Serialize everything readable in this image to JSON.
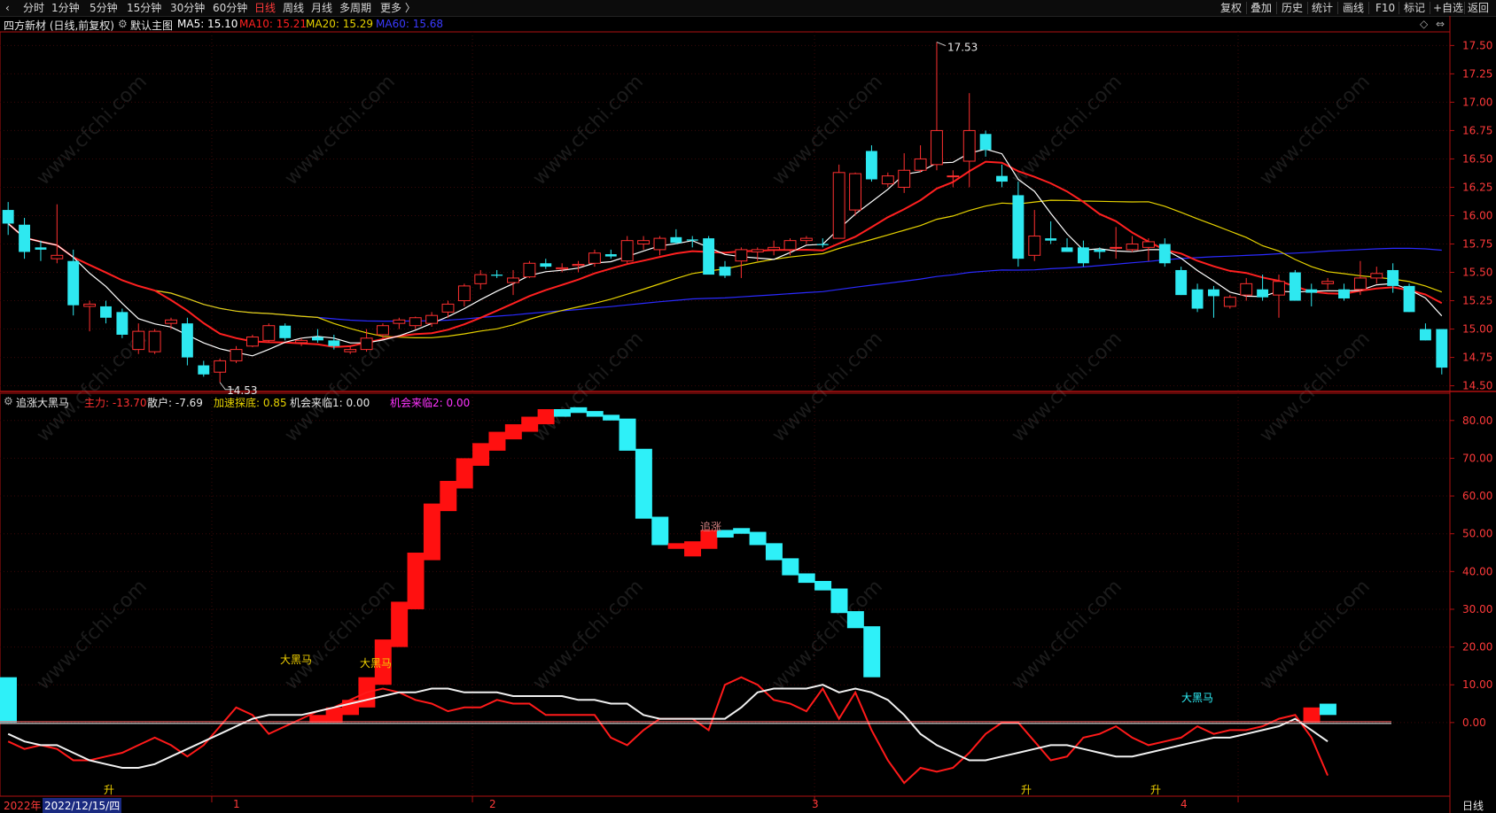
{
  "toolbar": {
    "tabs": [
      "分时",
      "1分钟",
      "5分钟",
      "15分钟",
      "30分钟",
      "60分钟",
      "日线",
      "周线",
      "月线",
      "多周期",
      "更多 〉"
    ],
    "active_tab": "日线",
    "right_buttons": [
      "复权",
      "叠加",
      "历史",
      "统计",
      "画线",
      "F10",
      "标记",
      "+自选",
      "返回"
    ]
  },
  "main_chart": {
    "stock_title": "四方新材 (日线,前复权)",
    "template": "默认主图",
    "ma5": {
      "label": "MA5: 15.10",
      "color": "#ffffff"
    },
    "ma10": {
      "label": "MA10: 15.21",
      "color": "#ff2020"
    },
    "ma20": {
      "label": "MA20: 15.29",
      "color": "#e6d200"
    },
    "ma60": {
      "label": "MA60: 15.68",
      "color": "#2a2aff"
    },
    "high_label": "17.53",
    "low_label": "14.53",
    "price_ticks": [
      "17.50",
      "17.25",
      "17.00",
      "16.75",
      "16.50",
      "16.25",
      "16.00",
      "15.75",
      "15.50",
      "15.25",
      "15.00",
      "14.75",
      "14.50"
    ]
  },
  "indicator": {
    "name": "追涨大黑马",
    "main_force": "主力: -13.70",
    "retail": "散户: -7.69",
    "accel": "加速探底: 0.85",
    "chance1": "机会来临1: 0.00",
    "chance2": "机会来临2: 0.00",
    "ticks": [
      "80.00",
      "70.00",
      "60.00",
      "50.00",
      "40.00",
      "30.00",
      "20.00",
      "10.00",
      "0.00"
    ],
    "annotations": {
      "dhm1": "大黑马",
      "dhm2": "大黑马",
      "dhm3": "大黑马",
      "zhuizhang": "追涨",
      "sheng1": "升",
      "sheng2": "升",
      "sheng3": "升"
    }
  },
  "time_axis": {
    "year_label": "2022年",
    "date_cursor": "2022/12/15/四",
    "months": [
      "1",
      "2",
      "3",
      "4"
    ],
    "period": "日线"
  },
  "watermark": "www.cfchi.com",
  "chart_data": [
    {
      "type": "candlestick",
      "title": "四方新材 (日线,前复权)",
      "ylim": [
        14.45,
        17.62
      ],
      "candles": [
        [
          16.05,
          16.12,
          15.83,
          15.93
        ],
        [
          15.92,
          15.98,
          15.62,
          15.68
        ],
        [
          15.72,
          15.78,
          15.6,
          15.7
        ],
        [
          15.62,
          16.1,
          15.58,
          15.65
        ],
        [
          15.6,
          15.7,
          15.12,
          15.21
        ],
        [
          15.2,
          15.25,
          14.98,
          15.22
        ],
        [
          15.2,
          15.25,
          15.05,
          15.1
        ],
        [
          15.15,
          15.18,
          14.92,
          14.95
        ],
        [
          14.82,
          15.05,
          14.78,
          14.98
        ],
        [
          14.8,
          15.0,
          14.78,
          14.98
        ],
        [
          15.05,
          15.1,
          15.0,
          15.08
        ],
        [
          15.05,
          15.1,
          14.68,
          14.75
        ],
        [
          14.68,
          14.72,
          14.58,
          14.6
        ],
        [
          14.62,
          14.74,
          14.53,
          14.72
        ],
        [
          14.72,
          14.85,
          14.7,
          14.82
        ],
        [
          14.85,
          14.95,
          14.84,
          14.93
        ],
        [
          14.9,
          15.05,
          14.88,
          15.03
        ],
        [
          15.03,
          15.05,
          14.9,
          14.92
        ],
        [
          14.88,
          14.92,
          14.85,
          14.9
        ],
        [
          14.93,
          15.0,
          14.88,
          14.9
        ],
        [
          14.9,
          14.95,
          14.82,
          14.85
        ],
        [
          14.8,
          14.85,
          14.78,
          14.82
        ],
        [
          14.82,
          15.0,
          14.8,
          14.92
        ],
        [
          14.95,
          15.05,
          14.92,
          15.03
        ],
        [
          15.05,
          15.1,
          15.0,
          15.08
        ],
        [
          15.03,
          15.11,
          15.0,
          15.1
        ],
        [
          15.05,
          15.15,
          15.02,
          15.12
        ],
        [
          15.15,
          15.25,
          15.1,
          15.22
        ],
        [
          15.25,
          15.4,
          15.2,
          15.38
        ],
        [
          15.4,
          15.52,
          15.35,
          15.48
        ],
        [
          15.48,
          15.52,
          15.45,
          15.47
        ],
        [
          15.41,
          15.52,
          15.3,
          15.45
        ],
        [
          15.46,
          15.6,
          15.45,
          15.58
        ],
        [
          15.58,
          15.62,
          15.53,
          15.55
        ],
        [
          15.53,
          15.58,
          15.5,
          15.54
        ],
        [
          15.56,
          15.6,
          15.5,
          15.57
        ],
        [
          15.58,
          15.7,
          15.55,
          15.67
        ],
        [
          15.66,
          15.7,
          15.62,
          15.64
        ],
        [
          15.6,
          15.82,
          15.58,
          15.78
        ],
        [
          15.75,
          15.82,
          15.7,
          15.78
        ],
        [
          15.7,
          15.82,
          15.65,
          15.8
        ],
        [
          15.81,
          15.88,
          15.75,
          15.76
        ],
        [
          15.79,
          15.82,
          15.72,
          15.78
        ],
        [
          15.8,
          15.82,
          15.65,
          15.48
        ],
        [
          15.55,
          15.6,
          15.45,
          15.47
        ],
        [
          15.6,
          15.72,
          15.45,
          15.7
        ],
        [
          15.68,
          15.72,
          15.6,
          15.7
        ],
        [
          15.7,
          15.78,
          15.65,
          15.72
        ],
        [
          15.7,
          15.8,
          15.65,
          15.78
        ],
        [
          15.78,
          15.82,
          15.75,
          15.8
        ],
        [
          15.75,
          15.8,
          15.72,
          15.74
        ],
        [
          15.8,
          16.45,
          15.85,
          16.38
        ],
        [
          16.05,
          16.38,
          16.0,
          16.37
        ],
        [
          16.57,
          16.62,
          16.3,
          16.32
        ],
        [
          16.28,
          16.38,
          16.25,
          16.35
        ],
        [
          16.25,
          16.55,
          16.2,
          16.4
        ],
        [
          16.4,
          16.62,
          16.38,
          16.5
        ],
        [
          16.45,
          17.53,
          16.4,
          16.75
        ],
        [
          16.35,
          16.4,
          16.25,
          16.35
        ],
        [
          16.48,
          17.08,
          16.25,
          16.75
        ],
        [
          16.72,
          16.75,
          16.52,
          16.58
        ],
        [
          16.35,
          16.45,
          16.25,
          16.3
        ],
        [
          16.18,
          16.3,
          15.55,
          15.62
        ],
        [
          15.65,
          16.05,
          15.6,
          15.82
        ],
        [
          15.8,
          15.95,
          15.75,
          15.78
        ],
        [
          15.72,
          15.8,
          15.68,
          15.68
        ],
        [
          15.72,
          15.78,
          15.55,
          15.58
        ],
        [
          15.7,
          15.72,
          15.62,
          15.68
        ],
        [
          15.72,
          15.9,
          15.62,
          15.72
        ],
        [
          15.7,
          15.82,
          15.68,
          15.75
        ],
        [
          15.72,
          15.8,
          15.6,
          15.77
        ],
        [
          15.75,
          15.8,
          15.55,
          15.58
        ],
        [
          15.52,
          15.55,
          15.3,
          15.3
        ],
        [
          15.35,
          15.4,
          15.15,
          15.18
        ],
        [
          15.35,
          15.38,
          15.1,
          15.29
        ],
        [
          15.2,
          15.3,
          15.18,
          15.28
        ],
        [
          15.3,
          15.45,
          15.25,
          15.4
        ],
        [
          15.35,
          15.48,
          15.25,
          15.28
        ],
        [
          15.3,
          15.48,
          15.1,
          15.42
        ],
        [
          15.5,
          15.52,
          15.25,
          15.25
        ],
        [
          15.35,
          15.4,
          15.2,
          15.32
        ],
        [
          15.4,
          15.45,
          15.35,
          15.42
        ],
        [
          15.35,
          15.4,
          15.25,
          15.27
        ],
        [
          15.35,
          15.6,
          15.3,
          15.45
        ],
        [
          15.45,
          15.55,
          15.4,
          15.49
        ],
        [
          15.52,
          15.58,
          15.32,
          15.38
        ],
        [
          15.38,
          15.4,
          15.15,
          15.15
        ],
        [
          15.0,
          15.05,
          14.9,
          14.9
        ],
        [
          15.0,
          15.0,
          14.6,
          14.66
        ]
      ]
    },
    {
      "type": "bar",
      "title": "追涨大黑马",
      "ylim": [
        -19.5,
        83
      ],
      "values": [
        12,
        0,
        0,
        0,
        0,
        0,
        0,
        0,
        0,
        0,
        0,
        0,
        0,
        0,
        0,
        0,
        0,
        0,
        0,
        2,
        4,
        6,
        12,
        22,
        32,
        45,
        58,
        64,
        70,
        74,
        77,
        79,
        81,
        83,
        83,
        82,
        81,
        80,
        72,
        54,
        47,
        46,
        48,
        51,
        51,
        50,
        47,
        43,
        39,
        37,
        35,
        29,
        25,
        12,
        0,
        0,
        0,
        0,
        0,
        0,
        0,
        0,
        0,
        0,
        0,
        0,
        0,
        0,
        0,
        0,
        0,
        0,
        0,
        0,
        0,
        0,
        0,
        0,
        0,
        0,
        4,
        5
      ],
      "colors": [
        "cyan",
        "black",
        "black",
        "black",
        "black",
        "black",
        "black",
        "black",
        "black",
        "black",
        "black",
        "black",
        "black",
        "black",
        "black",
        "black",
        "black",
        "black",
        "black",
        "red",
        "red",
        "red",
        "red",
        "red",
        "red",
        "red",
        "red",
        "red",
        "red",
        "red",
        "red",
        "red",
        "red",
        "red",
        "cyan",
        "cyan",
        "cyan",
        "cyan",
        "cyan",
        "cyan",
        "cyan",
        "red",
        "red",
        "red",
        "cyan",
        "cyan",
        "cyan",
        "cyan",
        "cyan",
        "cyan",
        "cyan",
        "cyan",
        "cyan",
        "cyan",
        "black",
        "black",
        "black",
        "black",
        "black",
        "black",
        "black",
        "black",
        "black",
        "black",
        "black",
        "black",
        "black",
        "black",
        "black",
        "black",
        "black",
        "black",
        "black",
        "black",
        "black",
        "black",
        "black",
        "black",
        "black",
        "black",
        "red",
        "cyan"
      ]
    }
  ]
}
